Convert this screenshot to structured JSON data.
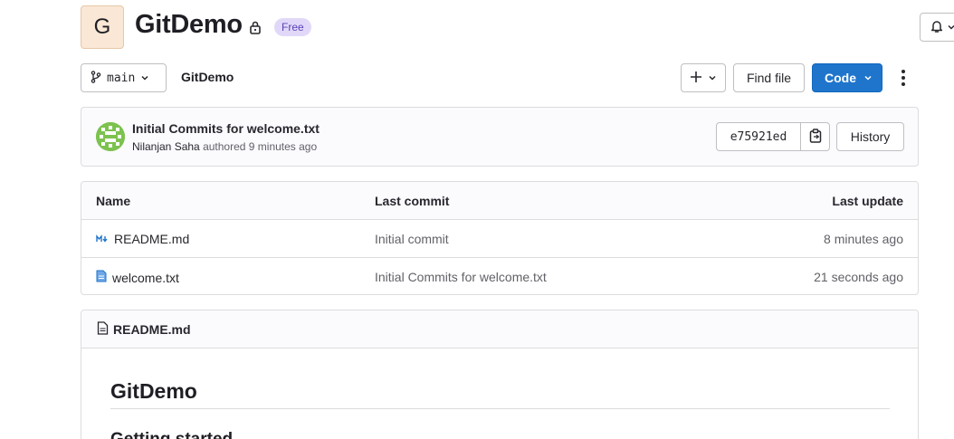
{
  "project": {
    "avatar_letter": "G",
    "name": "GitDemo",
    "visibility_icon": "lock-icon",
    "badge": "Free"
  },
  "toolbar": {
    "branch": "main",
    "breadcrumb": "GitDemo",
    "find_file": "Find file",
    "code": "Code"
  },
  "last_commit": {
    "title": "Initial Commits for welcome.txt",
    "author": "Nilanjan Saha",
    "authored_text": "authored 9 minutes ago",
    "sha": "e75921ed",
    "history": "History"
  },
  "files": {
    "headers": {
      "name": "Name",
      "last_commit": "Last commit",
      "last_update": "Last update"
    },
    "rows": [
      {
        "icon": "markdown-icon",
        "name": "README.md",
        "last_commit": "Initial commit",
        "last_update": "8 minutes ago"
      },
      {
        "icon": "file-text-icon",
        "name": "welcome.txt",
        "last_commit": "Initial Commits for welcome.txt",
        "last_update": "21 seconds ago"
      }
    ]
  },
  "readme": {
    "file_label": "README.md",
    "heading": "GitDemo",
    "subheading": "Getting started"
  },
  "colors": {
    "primary": "#1f75cb",
    "badge_bg": "#e1d8f9",
    "badge_text": "#5943b6",
    "avatar_bg": "#fae7d5"
  }
}
